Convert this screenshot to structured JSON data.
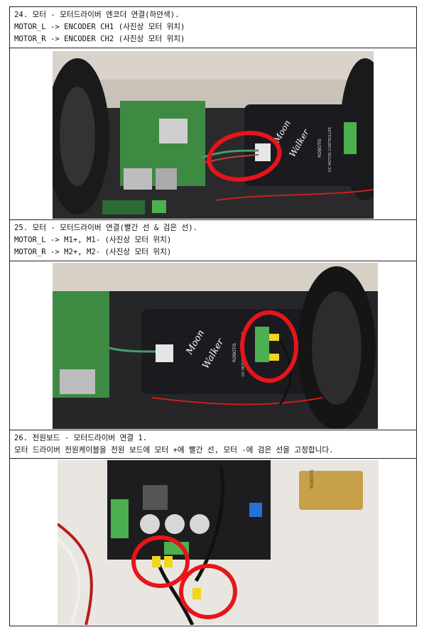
{
  "steps": [
    {
      "heading": "24. 모터 - 모터드라이버 엔코더 연결(하얀색).",
      "lines": [
        "MOTOR_L -> ENCODER CH1 (사진상 모터 위치)",
        "MOTOR_R -> ENCODER CH2 (사진상 모터 위치)"
      ],
      "photo_labels": [
        "Moon",
        "Walker",
        "ROBOTIS",
        "DC MOTOR CONTROLLER"
      ]
    },
    {
      "heading": "25. 모터 - 모터드라이버 연결(빨간 선 & 검은 선).",
      "lines": [
        "MOTOR_L -> M1+, M1- (사진상 모터 위치)",
        "MOTOR_R -> M2+, M2- (사진상 모터 위치)"
      ],
      "photo_labels": [
        "Moon",
        "Walker",
        "ROBOTIS",
        "DC MOTOR CONTROLLER"
      ]
    },
    {
      "heading": "26. 전원보드 - 모터드라이버 연결 1.",
      "lines": [
        "모터 드라이버 전원케이블을 전원 보드에 모터 +에 빨간 선, 모터 -에 검은 선을 고정합니다."
      ],
      "photo_labels": [
        "ROBOTIS"
      ]
    }
  ],
  "colors": {
    "highlight_circle": "#e8141b",
    "board_green": "#3a7d3a",
    "driver_black": "#1b1b1f",
    "gold": "#c8a04a"
  }
}
